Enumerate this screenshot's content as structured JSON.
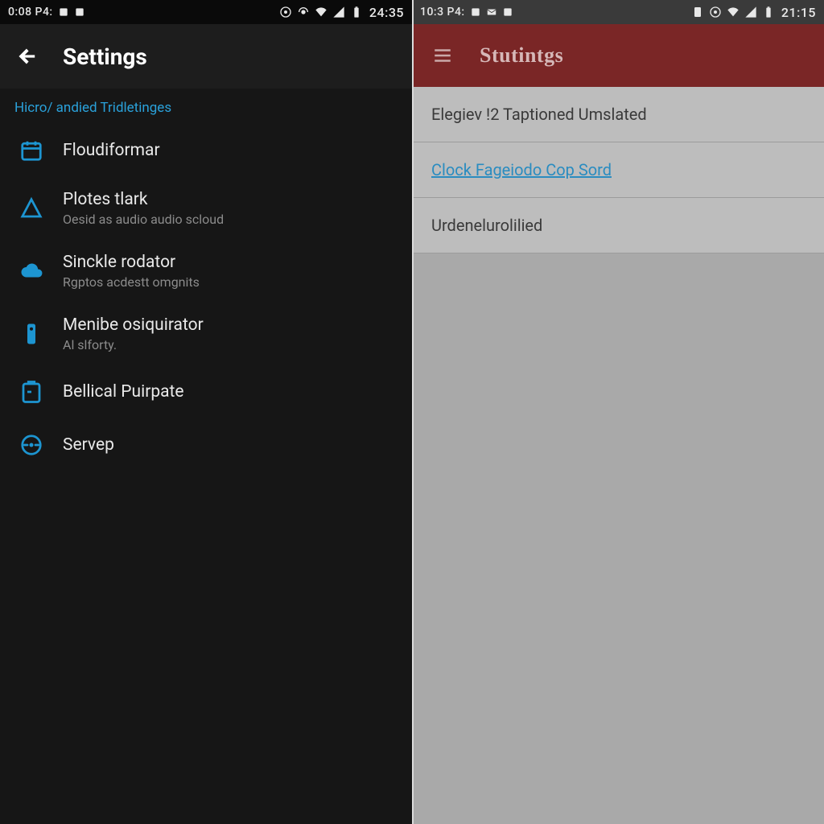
{
  "left": {
    "status": {
      "time_label": "0:08 P4:",
      "clock": "24:35"
    },
    "appbar": {
      "title": "Settings"
    },
    "section_header": "Hicro/ andied Tridletinges",
    "items": [
      {
        "icon": "calendar-icon",
        "title": "Floudiformar",
        "sub": ""
      },
      {
        "icon": "triangle-icon",
        "title": "Plotes tlark",
        "sub": "Oesid as audio audio scloud"
      },
      {
        "icon": "cloud-icon",
        "title": "Sinckle rodator",
        "sub": "Rgptos acdestt omgnits"
      },
      {
        "icon": "device-icon",
        "title": "Menibe osiquirator",
        "sub": "Al slforty."
      },
      {
        "icon": "clipboard-icon",
        "title": "Bellical Puirpate",
        "sub": ""
      },
      {
        "icon": "sync-icon",
        "title": "Servep",
        "sub": ""
      }
    ]
  },
  "right": {
    "status": {
      "time_label": "10:3 P4:",
      "clock": "21:15"
    },
    "appbar": {
      "title": "Stutintgs"
    },
    "rows": [
      {
        "kind": "text",
        "label": "Elegiev !2 Taptioned Umslated"
      },
      {
        "kind": "link",
        "label": "Clock Fageiodo Cop Sord"
      },
      {
        "kind": "text",
        "label": "Urdenelurolilied"
      }
    ]
  }
}
